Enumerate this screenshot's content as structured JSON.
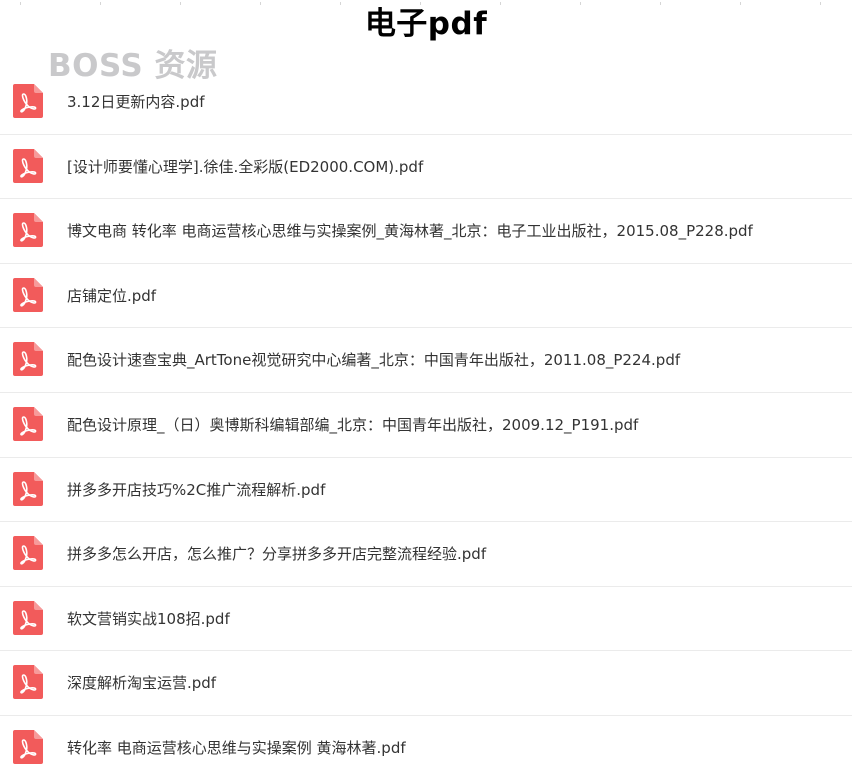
{
  "page": {
    "title": "电子pdf",
    "watermark": "BOSS 资源"
  },
  "colors": {
    "pdf_icon": "#f25b5b",
    "text": "#333333",
    "divider": "#ebebeb",
    "watermark": "#c9c9cb"
  },
  "files": [
    {
      "name": "3.12日更新内容.pdf",
      "icon": "pdf-icon"
    },
    {
      "name": "[设计师要懂心理学].徐佳.全彩版(ED2000.COM).pdf",
      "icon": "pdf-icon"
    },
    {
      "name": "博文电商 转化率 电商运营核心思维与实操案例_黄海林著_北京：电子工业出版社，2015.08_P228.pdf",
      "icon": "pdf-icon"
    },
    {
      "name": "店铺定位.pdf",
      "icon": "pdf-icon"
    },
    {
      "name": "配色设计速查宝典_ArtTone视觉研究中心编著_北京：中国青年出版社，2011.08_P224.pdf",
      "icon": "pdf-icon"
    },
    {
      "name": "配色设计原理_（日）奥博斯科编辑部编_北京：中国青年出版社，2009.12_P191.pdf",
      "icon": "pdf-icon"
    },
    {
      "name": "拼多多开店技巧%2C推广流程解析.pdf",
      "icon": "pdf-icon"
    },
    {
      "name": "拼多多怎么开店，怎么推广？分享拼多多开店完整流程经验.pdf",
      "icon": "pdf-icon"
    },
    {
      "name": "软文营销实战108招.pdf",
      "icon": "pdf-icon"
    },
    {
      "name": "深度解析淘宝运营.pdf",
      "icon": "pdf-icon"
    },
    {
      "name": "转化率 电商运营核心思维与实操案例 黄海林著.pdf",
      "icon": "pdf-icon"
    }
  ]
}
